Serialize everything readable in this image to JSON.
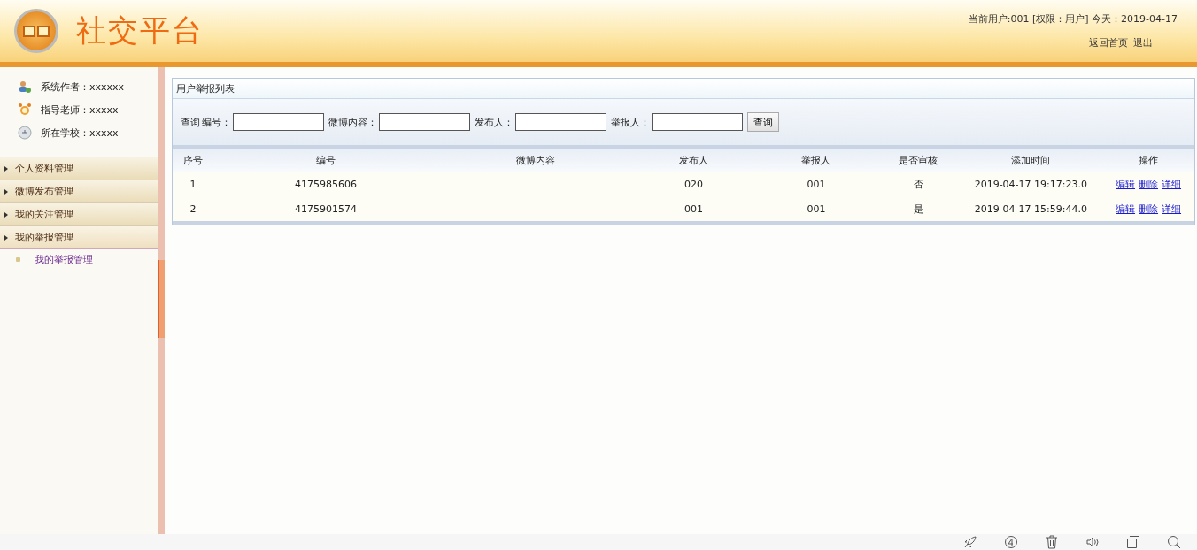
{
  "header": {
    "title": "社交平台",
    "user_info": "当前用户:001 [权限：用户] 今天：2019-04-17",
    "links": [
      "返回首页",
      "退出"
    ]
  },
  "sidebar": {
    "info": [
      {
        "kind": "author",
        "text": "系统作者：xxxxxx"
      },
      {
        "kind": "teacher",
        "text": "指导老师：xxxxx"
      },
      {
        "kind": "school",
        "text": "所在学校：xxxxx"
      }
    ],
    "menu": [
      {
        "label": "个人资料管理",
        "expanded": false
      },
      {
        "label": "微博发布管理",
        "expanded": false
      },
      {
        "label": "我的关注管理",
        "expanded": false
      },
      {
        "label": "我的举报管理",
        "expanded": true,
        "children": [
          {
            "label": "我的举报管理"
          }
        ]
      }
    ]
  },
  "panel": {
    "title": "用户举报列表",
    "search": {
      "prefix": "查询",
      "fields": [
        {
          "label": "编号："
        },
        {
          "label": "微博内容："
        },
        {
          "label": "发布人："
        },
        {
          "label": "举报人："
        }
      ],
      "button": "查询"
    },
    "table": {
      "columns": [
        "序号",
        "编号",
        "微博内容",
        "发布人",
        "举报人",
        "是否审核",
        "添加时间",
        "操作"
      ],
      "rows": [
        {
          "cells": [
            "1",
            "4175985606",
            "",
            "020",
            "001",
            "否",
            "2019-04-17 19:17:23.0"
          ],
          "actions": [
            "编辑",
            "删除",
            "详细"
          ]
        },
        {
          "cells": [
            "2",
            "4175901574",
            "",
            "001",
            "001",
            "是",
            "2019-04-17 15:59:44.0"
          ],
          "actions": [
            "编辑",
            "删除",
            "详细"
          ]
        }
      ]
    }
  },
  "bottom_toolbar": {
    "icons": [
      {
        "kind": "rocket"
      },
      {
        "kind": "circle"
      },
      {
        "kind": "trash"
      },
      {
        "kind": "speaker"
      },
      {
        "kind": "window"
      },
      {
        "kind": "search"
      }
    ]
  }
}
